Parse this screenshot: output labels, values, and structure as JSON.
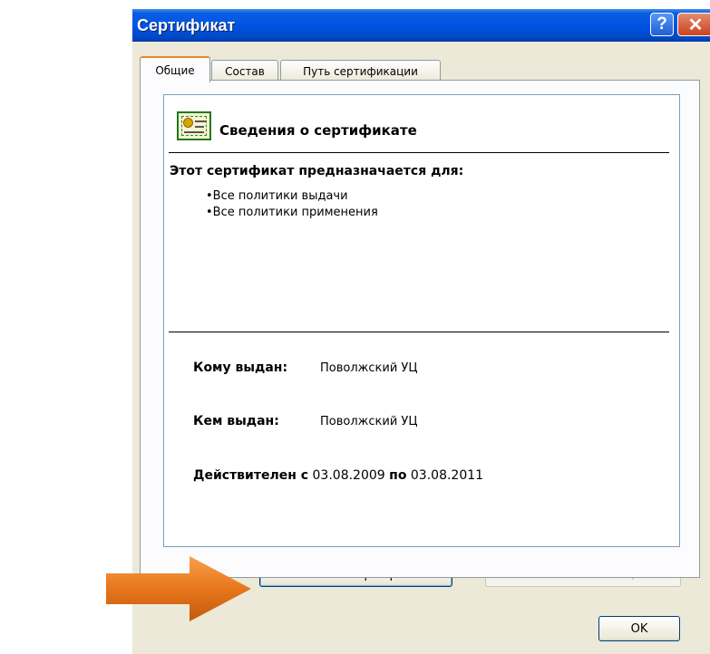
{
  "window": {
    "title": "Сертификат",
    "help_glyph": "?",
    "close_glyph": "✕"
  },
  "tabs": [
    {
      "label": "Общие",
      "active": true
    },
    {
      "label": "Состав",
      "active": false
    },
    {
      "label": "Путь сертификации",
      "active": false
    }
  ],
  "info": {
    "heading": "Сведения о сертификате",
    "purpose_title": "Этот сертификат предназначается для:",
    "purposes": [
      "•Все политики выдачи",
      "•Все политики применения"
    ],
    "issued_to_label": "Кому выдан:",
    "issued_to_value": "Поволжский УЦ",
    "issued_by_label": "Кем выдан:",
    "issued_by_value": "Поволжский УЦ",
    "valid_from_label": "Действителен с",
    "valid_from": "03.08.2009",
    "valid_to_label": "по",
    "valid_to": "03.08.2011"
  },
  "buttons": {
    "install": "Установить сертификат...",
    "issuer_statement": "Заявление поставщика",
    "ok": "OK"
  },
  "colors": {
    "titlebar": "#0054e3",
    "arrow": "#e8761c",
    "active_tab_accent": "#e68b2c"
  },
  "icons": {
    "certificate": "certificate-icon",
    "pointer_arrow": "arrow-right-icon"
  }
}
